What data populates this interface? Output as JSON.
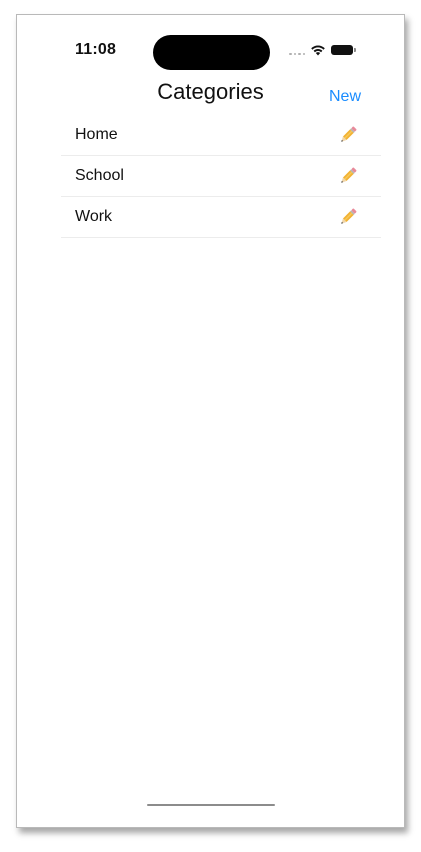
{
  "status_bar": {
    "time": "11:08",
    "icons": [
      "cellular-signal-icon",
      "wifi-icon",
      "battery-icon"
    ]
  },
  "nav": {
    "title": "Categories",
    "new_label": "New",
    "accent_color": "#1a8cff"
  },
  "categories": [
    {
      "label": "Home",
      "edit_icon": "pencil-icon"
    },
    {
      "label": "School",
      "edit_icon": "pencil-icon"
    },
    {
      "label": "Work",
      "edit_icon": "pencil-icon"
    }
  ]
}
